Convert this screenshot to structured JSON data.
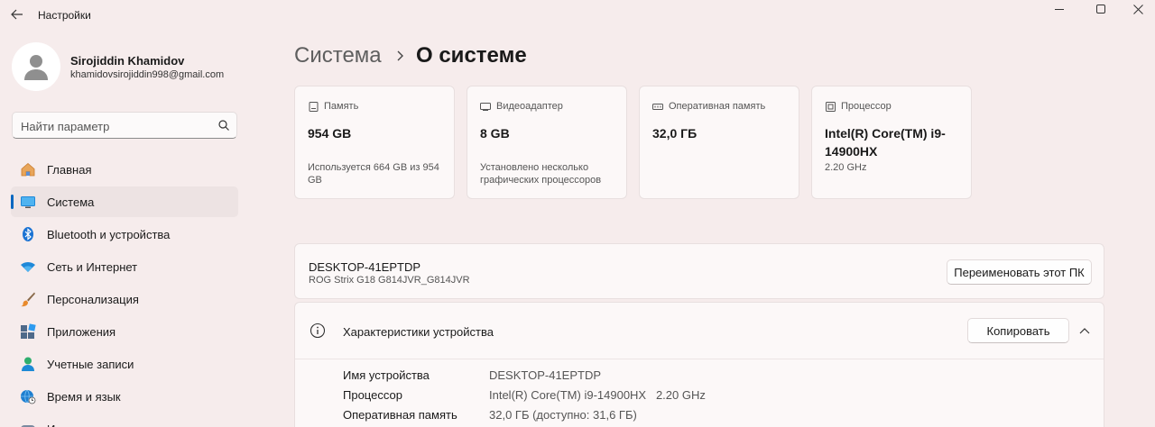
{
  "window": {
    "title": "Настройки"
  },
  "user": {
    "name": "Sirojiddin Khamidov",
    "email": "khamidovsirojiddin998@gmail.com"
  },
  "search": {
    "placeholder": "Найти параметр"
  },
  "sidebar": {
    "items": [
      {
        "label": "Главная",
        "icon": "home-icon",
        "active": false
      },
      {
        "label": "Система",
        "icon": "monitor-icon",
        "active": true
      },
      {
        "label": "Bluetooth и устройства",
        "icon": "bluetooth-icon",
        "active": false
      },
      {
        "label": "Сеть и Интернет",
        "icon": "wifi-icon",
        "active": false
      },
      {
        "label": "Персонализация",
        "icon": "brush-icon",
        "active": false
      },
      {
        "label": "Приложения",
        "icon": "apps-icon",
        "active": false
      },
      {
        "label": "Учетные записи",
        "icon": "person-icon",
        "active": false
      },
      {
        "label": "Время и язык",
        "icon": "globe-clock-icon",
        "active": false
      },
      {
        "label": "И",
        "icon": "game-icon",
        "active": false
      }
    ]
  },
  "breadcrumb": {
    "parent": "Система",
    "current": "О системе"
  },
  "cards": [
    {
      "label": "Память",
      "icon": "storage-icon",
      "value": "954 GB",
      "note": "Используется 664 GB из 954 GB"
    },
    {
      "label": "Видеоадаптер",
      "icon": "gpu-icon",
      "value": "8 GB",
      "note": "Установлено несколько графических процессоров"
    },
    {
      "label": "Оперативная память",
      "icon": "ram-icon",
      "value": "32,0 ГБ",
      "note": ""
    },
    {
      "label": "Процессор",
      "icon": "cpu-icon",
      "value": "Intel(R) Core(TM) i9-14900HX",
      "note": "2.20 GHz"
    }
  ],
  "pc": {
    "name": "DESKTOP-41EPTDP",
    "model": "ROG Strix G18 G814JVR_G814JVR",
    "rename_label": "Переименовать этот ПК"
  },
  "specs": {
    "title": "Характеристики устройства",
    "copy_label": "Копировать",
    "rows": [
      {
        "key": "Имя устройства",
        "value": "DESKTOP-41EPTDP"
      },
      {
        "key": "Процессор",
        "value": "Intel(R) Core(TM) i9-14900HX   2.20 GHz"
      },
      {
        "key": "Оперативная память",
        "value": "32,0 ГБ (доступно: 31,6 ГБ)"
      }
    ]
  },
  "colors": {
    "background": "#f6ecec",
    "accent": "#0067c0",
    "card": "#fcf8f8"
  }
}
